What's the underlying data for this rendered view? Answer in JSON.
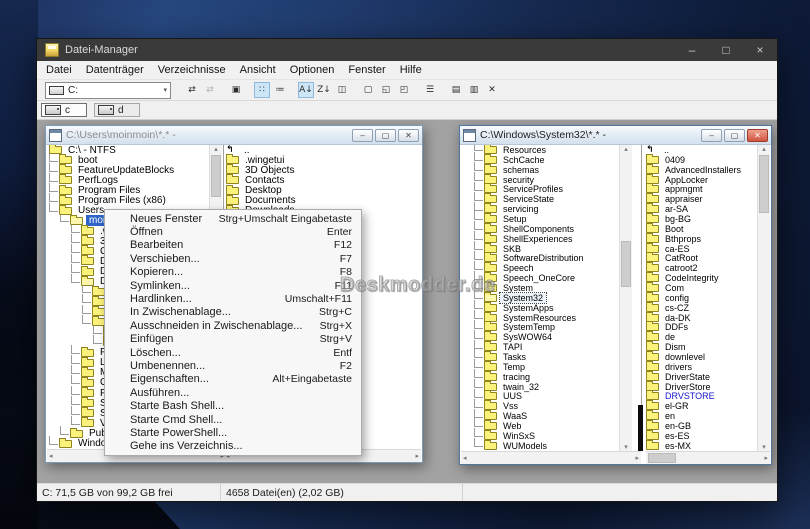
{
  "app": {
    "title": "Datei-Manager",
    "controls": {
      "minimize": "–",
      "maximize": "□",
      "close": "×"
    },
    "menubar": [
      "Datei",
      "Datenträger",
      "Verzeichnisse",
      "Ansicht",
      "Optionen",
      "Fenster",
      "Hilfe"
    ],
    "toolbar": {
      "drive_combo": {
        "value": "C:",
        "chevron": "▾"
      },
      "buttons": [
        {
          "name": "connect-network-drive-button",
          "glyph": "⇄",
          "state": "normal"
        },
        {
          "name": "disconnect-network-drive-button",
          "glyph": "⇄",
          "state": "disabled"
        },
        {
          "name": "share-folder-button",
          "glyph": "▣",
          "state": "normal",
          "gap": true
        },
        {
          "name": "view-names-button",
          "glyph": "∷",
          "state": "active",
          "gap": true
        },
        {
          "name": "view-details-button",
          "glyph": "≔",
          "state": "normal"
        },
        {
          "name": "sort-by-name-button",
          "glyph": "A↓",
          "state": "active",
          "gap": true
        },
        {
          "name": "sort-by-type-button",
          "glyph": "Z↓",
          "state": "normal"
        },
        {
          "name": "sort-by-size-button",
          "glyph": "◫",
          "state": "normal"
        },
        {
          "name": "new-window-button",
          "glyph": "▢",
          "state": "normal",
          "gap": true
        },
        {
          "name": "cascade-windows-button",
          "glyph": "◱",
          "state": "normal"
        },
        {
          "name": "tile-windows-button",
          "glyph": "◰",
          "state": "normal"
        },
        {
          "name": "print-button",
          "glyph": "☰",
          "state": "normal",
          "gap": true
        },
        {
          "name": "copy-button",
          "glyph": "▤",
          "state": "normal",
          "gap": true
        },
        {
          "name": "paste-button",
          "glyph": "▥",
          "state": "normal"
        },
        {
          "name": "delete-button",
          "glyph": "✕",
          "state": "normal"
        }
      ]
    },
    "drivebar": [
      {
        "name": "drive-c-button",
        "label": "c",
        "selected": true
      },
      {
        "name": "drive-d-button",
        "label": "d",
        "selected": false
      }
    ],
    "statusbar": {
      "disk": "C: 71,5 GB von 99,2 GB frei",
      "files": "4658 Datei(en) (2,02 GB)"
    }
  },
  "left_window": {
    "title": "C:\\Users\\moinmoin\\*.* -",
    "controls": {
      "minimize": "‒",
      "maximize": "▢",
      "close": "✕"
    },
    "tree": [
      {
        "label": "C:\\ - NTFS",
        "depth": 0
      },
      {
        "label": "boot",
        "depth": 1
      },
      {
        "label": "FeatureUpdateBlocks",
        "depth": 1
      },
      {
        "label": "PerfLogs",
        "depth": 1
      },
      {
        "label": "Program Files",
        "depth": 1
      },
      {
        "label": "Program Files (x86)",
        "depth": 1
      },
      {
        "label": "Users",
        "depth": 1
      },
      {
        "label": "moinmoin",
        "depth": 2,
        "selected": true,
        "open": true
      },
      {
        "label": ".wingetui",
        "depth": 3
      },
      {
        "label": "3D Objects",
        "depth": 3
      },
      {
        "label": "Contacts",
        "depth": 3
      },
      {
        "label": "Desktop",
        "depth": 3
      },
      {
        "label": "Documents",
        "depth": 3
      },
      {
        "label": "Downloads",
        "depth": 3,
        "open": true
      },
      {
        "label": "",
        "depth": 4
      },
      {
        "label": "",
        "depth": 4
      },
      {
        "label": "",
        "depth": 4
      },
      {
        "label": "",
        "depth": 4
      },
      {
        "label": "",
        "depth": 5
      },
      {
        "label": "",
        "depth": 5
      },
      {
        "label": "Favorites",
        "depth": 3
      },
      {
        "label": "Links",
        "depth": 3
      },
      {
        "label": "Music",
        "depth": 3
      },
      {
        "label": "OneDrive",
        "depth": 3
      },
      {
        "label": "Pictures",
        "depth": 3
      },
      {
        "label": "Saved Games",
        "depth": 3
      },
      {
        "label": "Searches",
        "depth": 3
      },
      {
        "label": "Videos",
        "depth": 3
      },
      {
        "label": "Public",
        "depth": 2
      },
      {
        "label": "Windows",
        "depth": 1
      }
    ],
    "files": [
      {
        "label": "..",
        "up": true
      },
      {
        "label": ".wingetui"
      },
      {
        "label": "3D Objects"
      },
      {
        "label": "Contacts"
      },
      {
        "label": "Desktop"
      },
      {
        "label": "Documents"
      },
      {
        "label": "Downloads"
      }
    ]
  },
  "right_window": {
    "title": "C:\\Windows\\System32\\*.* -",
    "controls": {
      "minimize": "‒",
      "maximize": "▢",
      "close": "✕"
    },
    "tree": [
      {
        "label": "Resources",
        "depth": 2
      },
      {
        "label": "SchCache",
        "depth": 2
      },
      {
        "label": "schemas",
        "depth": 2
      },
      {
        "label": "security",
        "depth": 2
      },
      {
        "label": "ServiceProfiles",
        "depth": 2
      },
      {
        "label": "ServiceState",
        "depth": 2
      },
      {
        "label": "servicing",
        "depth": 2
      },
      {
        "label": "Setup",
        "depth": 2
      },
      {
        "label": "ShellComponents",
        "depth": 2
      },
      {
        "label": "ShellExperiences",
        "depth": 2
      },
      {
        "label": "SKB",
        "depth": 2
      },
      {
        "label": "SoftwareDistribution",
        "depth": 2
      },
      {
        "label": "Speech",
        "depth": 2
      },
      {
        "label": "Speech_OneCore",
        "depth": 2
      },
      {
        "label": "System",
        "depth": 2
      },
      {
        "label": "System32",
        "depth": 2,
        "focus": true,
        "open": true
      },
      {
        "label": "SystemApps",
        "depth": 2
      },
      {
        "label": "SystemResources",
        "depth": 2
      },
      {
        "label": "SystemTemp",
        "depth": 2
      },
      {
        "label": "SysWOW64",
        "depth": 2
      },
      {
        "label": "TAPI",
        "depth": 2
      },
      {
        "label": "Tasks",
        "depth": 2
      },
      {
        "label": "Temp",
        "depth": 2
      },
      {
        "label": "tracing",
        "depth": 2
      },
      {
        "label": "twain_32",
        "depth": 2
      },
      {
        "label": "UUS",
        "depth": 2
      },
      {
        "label": "Vss",
        "depth": 2
      },
      {
        "label": "WaaS",
        "depth": 2
      },
      {
        "label": "Web",
        "depth": 2
      },
      {
        "label": "WinSxS",
        "depth": 2
      },
      {
        "label": "WUModels",
        "depth": 2
      }
    ],
    "files": [
      {
        "label": "..",
        "up": true
      },
      {
        "label": "0409"
      },
      {
        "label": "AdvancedInstallers"
      },
      {
        "label": "AppLocker"
      },
      {
        "label": "appmgmt"
      },
      {
        "label": "appraiser"
      },
      {
        "label": "ar-SA"
      },
      {
        "label": "bg-BG"
      },
      {
        "label": "Boot"
      },
      {
        "label": "Bthprops"
      },
      {
        "label": "ca-ES"
      },
      {
        "label": "CatRoot"
      },
      {
        "label": "catroot2"
      },
      {
        "label": "CodeIntegrity"
      },
      {
        "label": "Com"
      },
      {
        "label": "config"
      },
      {
        "label": "cs-CZ"
      },
      {
        "label": "da-DK"
      },
      {
        "label": "DDFs"
      },
      {
        "label": "de"
      },
      {
        "label": "Dism"
      },
      {
        "label": "downlevel"
      },
      {
        "label": "drivers"
      },
      {
        "label": "DriverState"
      },
      {
        "label": "DriverStore"
      },
      {
        "label": "DRVSTORE",
        "link": true
      },
      {
        "label": "el-GR"
      },
      {
        "label": "en"
      },
      {
        "label": "en-GB"
      },
      {
        "label": "es-ES"
      },
      {
        "label": "es-MX"
      }
    ]
  },
  "context_menu": {
    "items": [
      {
        "label": "Neues Fenster",
        "shortcut": "Strg+Umschalt Eingabetaste"
      },
      {
        "label": "Öffnen",
        "shortcut": "Enter"
      },
      {
        "label": "Bearbeiten",
        "shortcut": "F12"
      },
      {
        "label": "Verschieben...",
        "shortcut": "F7"
      },
      {
        "label": "Kopieren...",
        "shortcut": "F8"
      },
      {
        "label": "Symlinken...",
        "shortcut": "F11"
      },
      {
        "label": "Hardlinken...",
        "shortcut": "Umschalt+F11"
      },
      {
        "label": "In Zwischenablage...",
        "shortcut": "Strg+C"
      },
      {
        "label": "Ausschneiden in Zwischenablage...",
        "shortcut": "Strg+X"
      },
      {
        "label": "Einfügen",
        "shortcut": "Strg+V"
      },
      {
        "label": "Löschen...",
        "shortcut": "Entf"
      },
      {
        "label": "Umbenennen...",
        "shortcut": "F2"
      },
      {
        "label": "Eigenschaften...",
        "shortcut": "Alt+Eingabetaste"
      },
      {
        "label": "Ausführen...",
        "shortcut": ""
      },
      {
        "label": "Starte Bash Shell...",
        "shortcut": ""
      },
      {
        "label": "Starte Cmd Shell...",
        "shortcut": ""
      },
      {
        "label": "Starte PowerShell...",
        "shortcut": ""
      },
      {
        "label": "Gehe ins Verzeichnis...",
        "shortcut": ""
      }
    ]
  },
  "icons": {
    "scroll_up": "▴",
    "scroll_down": "▾",
    "scroll_left": "◂",
    "scroll_right": "▸"
  },
  "colors": {
    "selection": "#2e63c7",
    "link_folder": "#1515cc",
    "active_close": "#cf5440",
    "folder_yellow": "#fbf27c"
  },
  "watermark": "Deskmodder.de"
}
